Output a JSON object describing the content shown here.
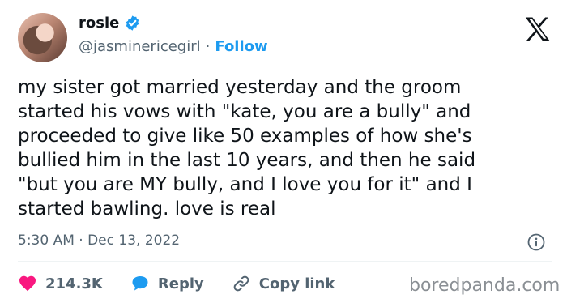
{
  "author": {
    "name": "rosie",
    "handle": "@jasminericegirl",
    "separator": "·",
    "follow_label": "Follow"
  },
  "tweet": {
    "text": "my sister got married yesterday and the groom\nstarted his vows with \"kate, you are a bully\" and\nproceeded to give like 50 examples of how she's\nbullied him in the last 10 years, and then he said\n\"but you are MY bully, and I love you for it\" and I\nstarted bawling. love is real",
    "timestamp": "5:30 AM · Dec 13, 2022"
  },
  "actions": {
    "likes": "214.3K",
    "reply_label": "Reply",
    "copy_link_label": "Copy link"
  },
  "watermark": "boredpanda.com",
  "colors": {
    "verified": "#1d9bf0",
    "follow": "#1d9bf0",
    "like": "#f91880",
    "reply": "#1d9bf0",
    "secondary_text": "#536471"
  },
  "icons": [
    "x-logo-icon",
    "verified-badge-icon",
    "info-icon",
    "heart-icon",
    "reply-bubble-icon",
    "link-icon"
  ]
}
